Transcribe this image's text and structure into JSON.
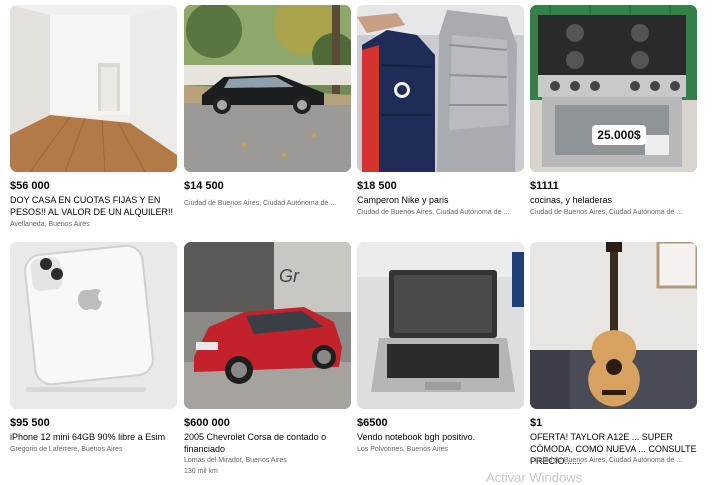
{
  "listings": [
    {
      "price": "$56 000",
      "title": "DOY CASA EN CUOTAS FIJAS Y EN PESOS!! AL VALOR DE UN ALQUILER!!",
      "location": "Avellaneda, Buenos Aires"
    },
    {
      "price": "$14 500",
      "title": "",
      "location": "Ciudad de Buenos Aires, Ciudad Autónoma de ..."
    },
    {
      "price": "$18 500",
      "title": "Camperon Nike y paris",
      "location": "Ciudad de Buenos Aires, Ciudad Autónoma de ..."
    },
    {
      "price": "$1111",
      "title": "cocinas, y heladeras",
      "location": "Ciudad de Buenos Aires, Ciudad Autónoma de ...",
      "tag_text": "25.000$"
    },
    {
      "price": "$95 500",
      "title": "iPhone 12 mini 64GB 90% libre a Esim",
      "location": "Gregorio de Laferrere, Buenos Aires"
    },
    {
      "price": "$600 000",
      "title": "2005 Chevrolet Corsa de contado o financiado",
      "location": "Lomas del Mirador, Buenos Aires",
      "mileage": "130 mil km"
    },
    {
      "price": "$6500",
      "title": "Vendo notebook bgh positivo.",
      "location": "Los Polvorines, Buenos Aires"
    },
    {
      "price": "$1",
      "title": "OFERTA! TAYLOR A12E ... SUPER CÓMODA, COMO NUEVA ... CONSULTE PRECIO.......",
      "location": "Ciudad de Buenos Aires, Ciudad Autónoma de ..."
    }
  ],
  "watermark": "Activar Windows"
}
